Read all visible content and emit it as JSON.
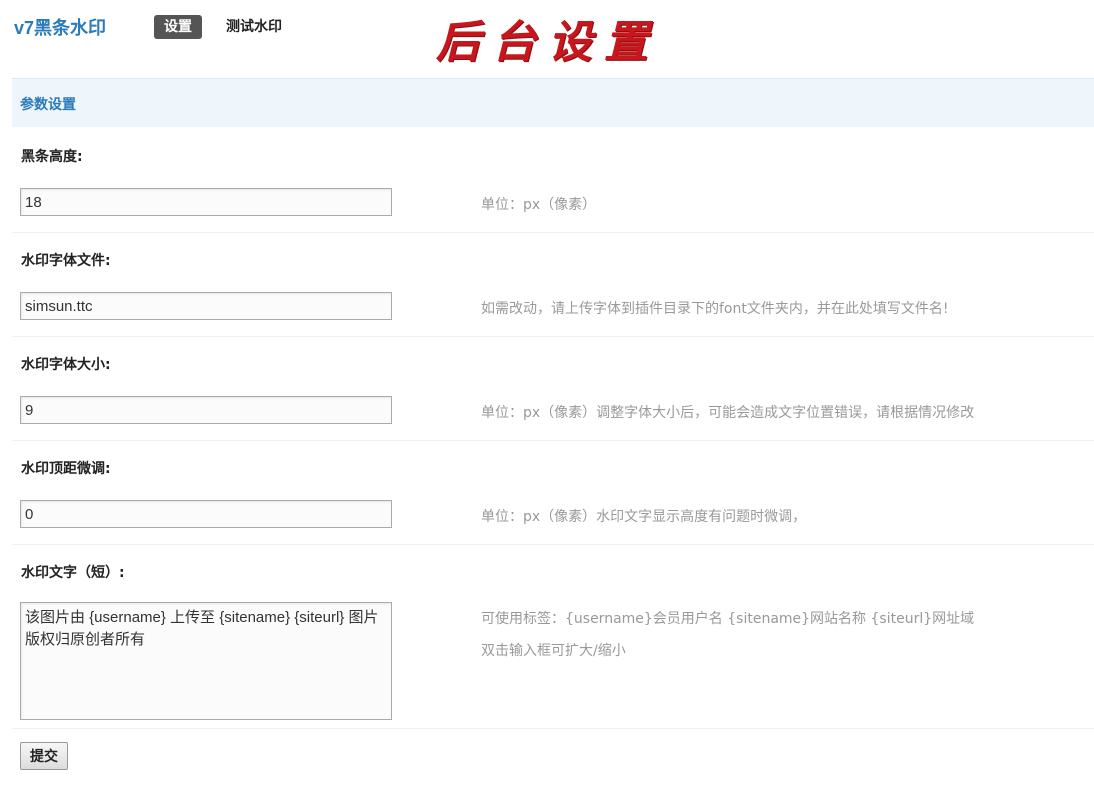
{
  "header": {
    "plugin_name": "v7黑条水印",
    "tabs": [
      {
        "label": "设置",
        "active": true
      },
      {
        "label": "测试水印",
        "active": false
      }
    ],
    "overlay_title": "后台设置",
    "overlay_color": "#c8161d"
  },
  "section": {
    "title": "参数设置"
  },
  "fields": [
    {
      "label": "黑条高度:",
      "value": "18",
      "hint": "单位：px（像素）"
    },
    {
      "label": "水印字体文件:",
      "value": "simsun.ttc",
      "hint": "如需改动，请上传字体到插件目录下的font文件夹内，并在此处填写文件名!"
    },
    {
      "label": "水印字体大小:",
      "value": "9",
      "hint": "单位：px（像素）调整字体大小后，可能会造成文字位置错误，请根据情况修改"
    },
    {
      "label": "水印顶距微调:",
      "value": "0",
      "hint": "单位：px（像素）水印文字显示高度有问题时微调，"
    },
    {
      "label": "水印文字（短）:",
      "value": "该图片由 {username} 上传至 {sitename} {siteurl} 图片版权归原创者所有",
      "hint": "可使用标签：{username}会员用户名 {sitename}网站名称 {siteurl}网址域",
      "hint2": "双击输入框可扩大/缩小"
    }
  ],
  "submit_label": "提交",
  "colors": {
    "accent": "#2b7bb9",
    "section_bg": "#eef5fb",
    "hint": "#999999"
  }
}
